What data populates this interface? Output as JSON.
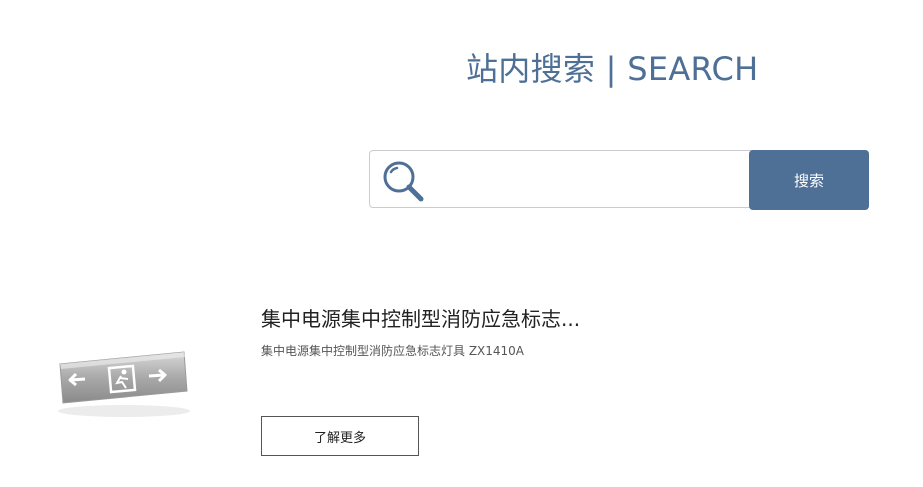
{
  "header": {
    "title": "站内搜索 | SEARCH"
  },
  "search": {
    "placeholder": "",
    "value": "",
    "button_label": "搜索",
    "icon": "search-icon"
  },
  "results": [
    {
      "title": "集中电源集中控制型消防应急标志...",
      "description": "集中电源集中控制型消防应急标志灯具 ZX1410A",
      "button_label": "了解更多",
      "image": "exit-sign-image"
    }
  ],
  "colors": {
    "accent": "#4e6f96",
    "border": "#c9cdd2"
  }
}
